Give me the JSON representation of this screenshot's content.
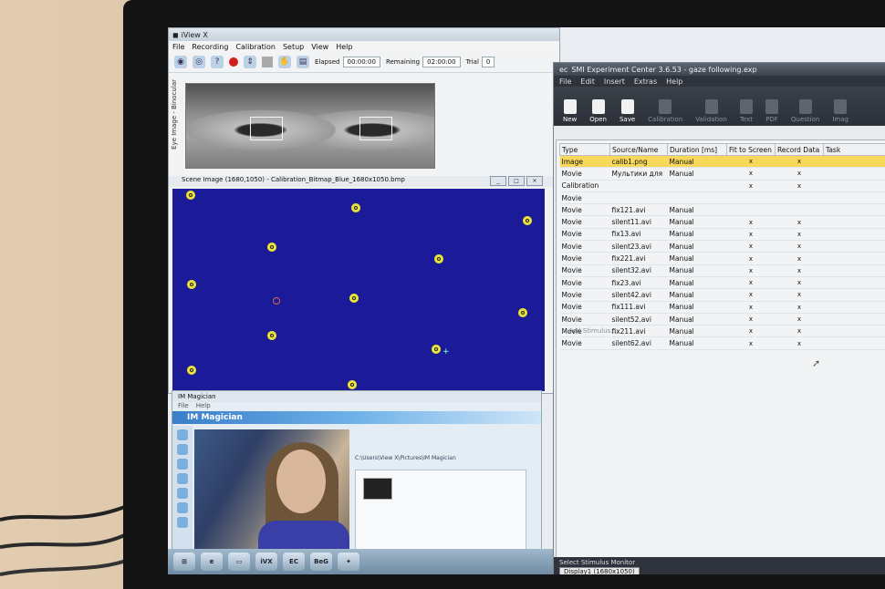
{
  "iview": {
    "title": "iView X",
    "menu": [
      "File",
      "Recording",
      "Calibration",
      "Setup",
      "View",
      "Help"
    ],
    "elapsed_label": "Elapsed",
    "elapsed_value": "00:00:00",
    "remaining_label": "Remaining",
    "remaining_value": "02:00:00",
    "trial_label": "Trial",
    "trial_value": "0",
    "eye_panel_label": "Eye Image - Binocular",
    "scene_title": "Scene Image (1680,1050) - Calibration_Bitmap_Blue_1680x1050.bmp"
  },
  "magician": {
    "title": "IM Magician",
    "menu": [
      "File",
      "Help"
    ],
    "banner": "IM Magician",
    "path": "C:\\Users\\View X\\Pictures\\IM Magician"
  },
  "smi": {
    "title": "SMI Experiment Center 3.6.53 - gaze following.exp",
    "menu": [
      "File",
      "Edit",
      "Insert",
      "Extras",
      "Help"
    ],
    "tools": [
      {
        "label": "New",
        "enabled": true
      },
      {
        "label": "Open",
        "enabled": true
      },
      {
        "label": "Save",
        "enabled": true
      },
      {
        "label": "Calibration",
        "enabled": false
      },
      {
        "label": "Validation",
        "enabled": false
      },
      {
        "label": "Text",
        "enabled": false
      },
      {
        "label": "PDF",
        "enabled": false
      },
      {
        "label": "Question",
        "enabled": false
      },
      {
        "label": "Imag",
        "enabled": false
      }
    ],
    "columns": [
      "Type",
      "Source/Name",
      "Duration [ms]",
      "Fit to Screen",
      "Record Data",
      "Task"
    ],
    "rows": [
      {
        "type": "Image",
        "name": "calib1.png",
        "duration": "Manual",
        "fit": "x",
        "record": "x"
      },
      {
        "type": "Movie",
        "name": "Мультики для",
        "duration": "Manual",
        "fit": "x",
        "record": "x"
      },
      {
        "type": "Calibration",
        "name": "",
        "duration": "",
        "fit": "x",
        "record": "x"
      },
      {
        "type": "Movie",
        "name": "",
        "duration": "",
        "fit": "",
        "record": ""
      },
      {
        "type": "Movie",
        "name": "fix121.avi",
        "duration": "Manual",
        "fit": "",
        "record": ""
      },
      {
        "type": "Movie",
        "name": "silent11.avi",
        "duration": "Manual",
        "fit": "x",
        "record": "x"
      },
      {
        "type": "Movie",
        "name": "fix13.avi",
        "duration": "Manual",
        "fit": "x",
        "record": "x"
      },
      {
        "type": "Movie",
        "name": "silent23.avi",
        "duration": "Manual",
        "fit": "x",
        "record": "x"
      },
      {
        "type": "Movie",
        "name": "fix221.avi",
        "duration": "Manual",
        "fit": "x",
        "record": "x"
      },
      {
        "type": "Movie",
        "name": "silent32.avi",
        "duration": "Manual",
        "fit": "x",
        "record": "x"
      },
      {
        "type": "Movie",
        "name": "fix23.avi",
        "duration": "Manual",
        "fit": "x",
        "record": "x"
      },
      {
        "type": "Movie",
        "name": "silent42.avi",
        "duration": "Manual",
        "fit": "x",
        "record": "x"
      },
      {
        "type": "Movie",
        "name": "fix111.avi",
        "duration": "Manual",
        "fit": "x",
        "record": "x"
      },
      {
        "type": "Movie",
        "name": "silent52.avi",
        "duration": "Manual",
        "fit": "x",
        "record": "x"
      },
      {
        "type": "Movie",
        "name": "fix211.avi",
        "duration": "Manual",
        "fit": "x",
        "record": "x"
      },
      {
        "type": "Movie",
        "name": "silent62.avi",
        "duration": "Manual",
        "fit": "x",
        "record": "x"
      }
    ],
    "add_stimulus": "+ Add Stimulus...",
    "monitor_label": "Select Stimulus Monitor",
    "monitor_value": "Display1 (1680x1050)"
  },
  "taskbar": {
    "items": [
      "iVX",
      "EC",
      "BeG"
    ]
  },
  "colors": {
    "scene_bg": "#1b1b9a",
    "target_dot": "#e8e23a",
    "selected_row": "#f7d85b",
    "smi_dark": "#2f343c"
  }
}
